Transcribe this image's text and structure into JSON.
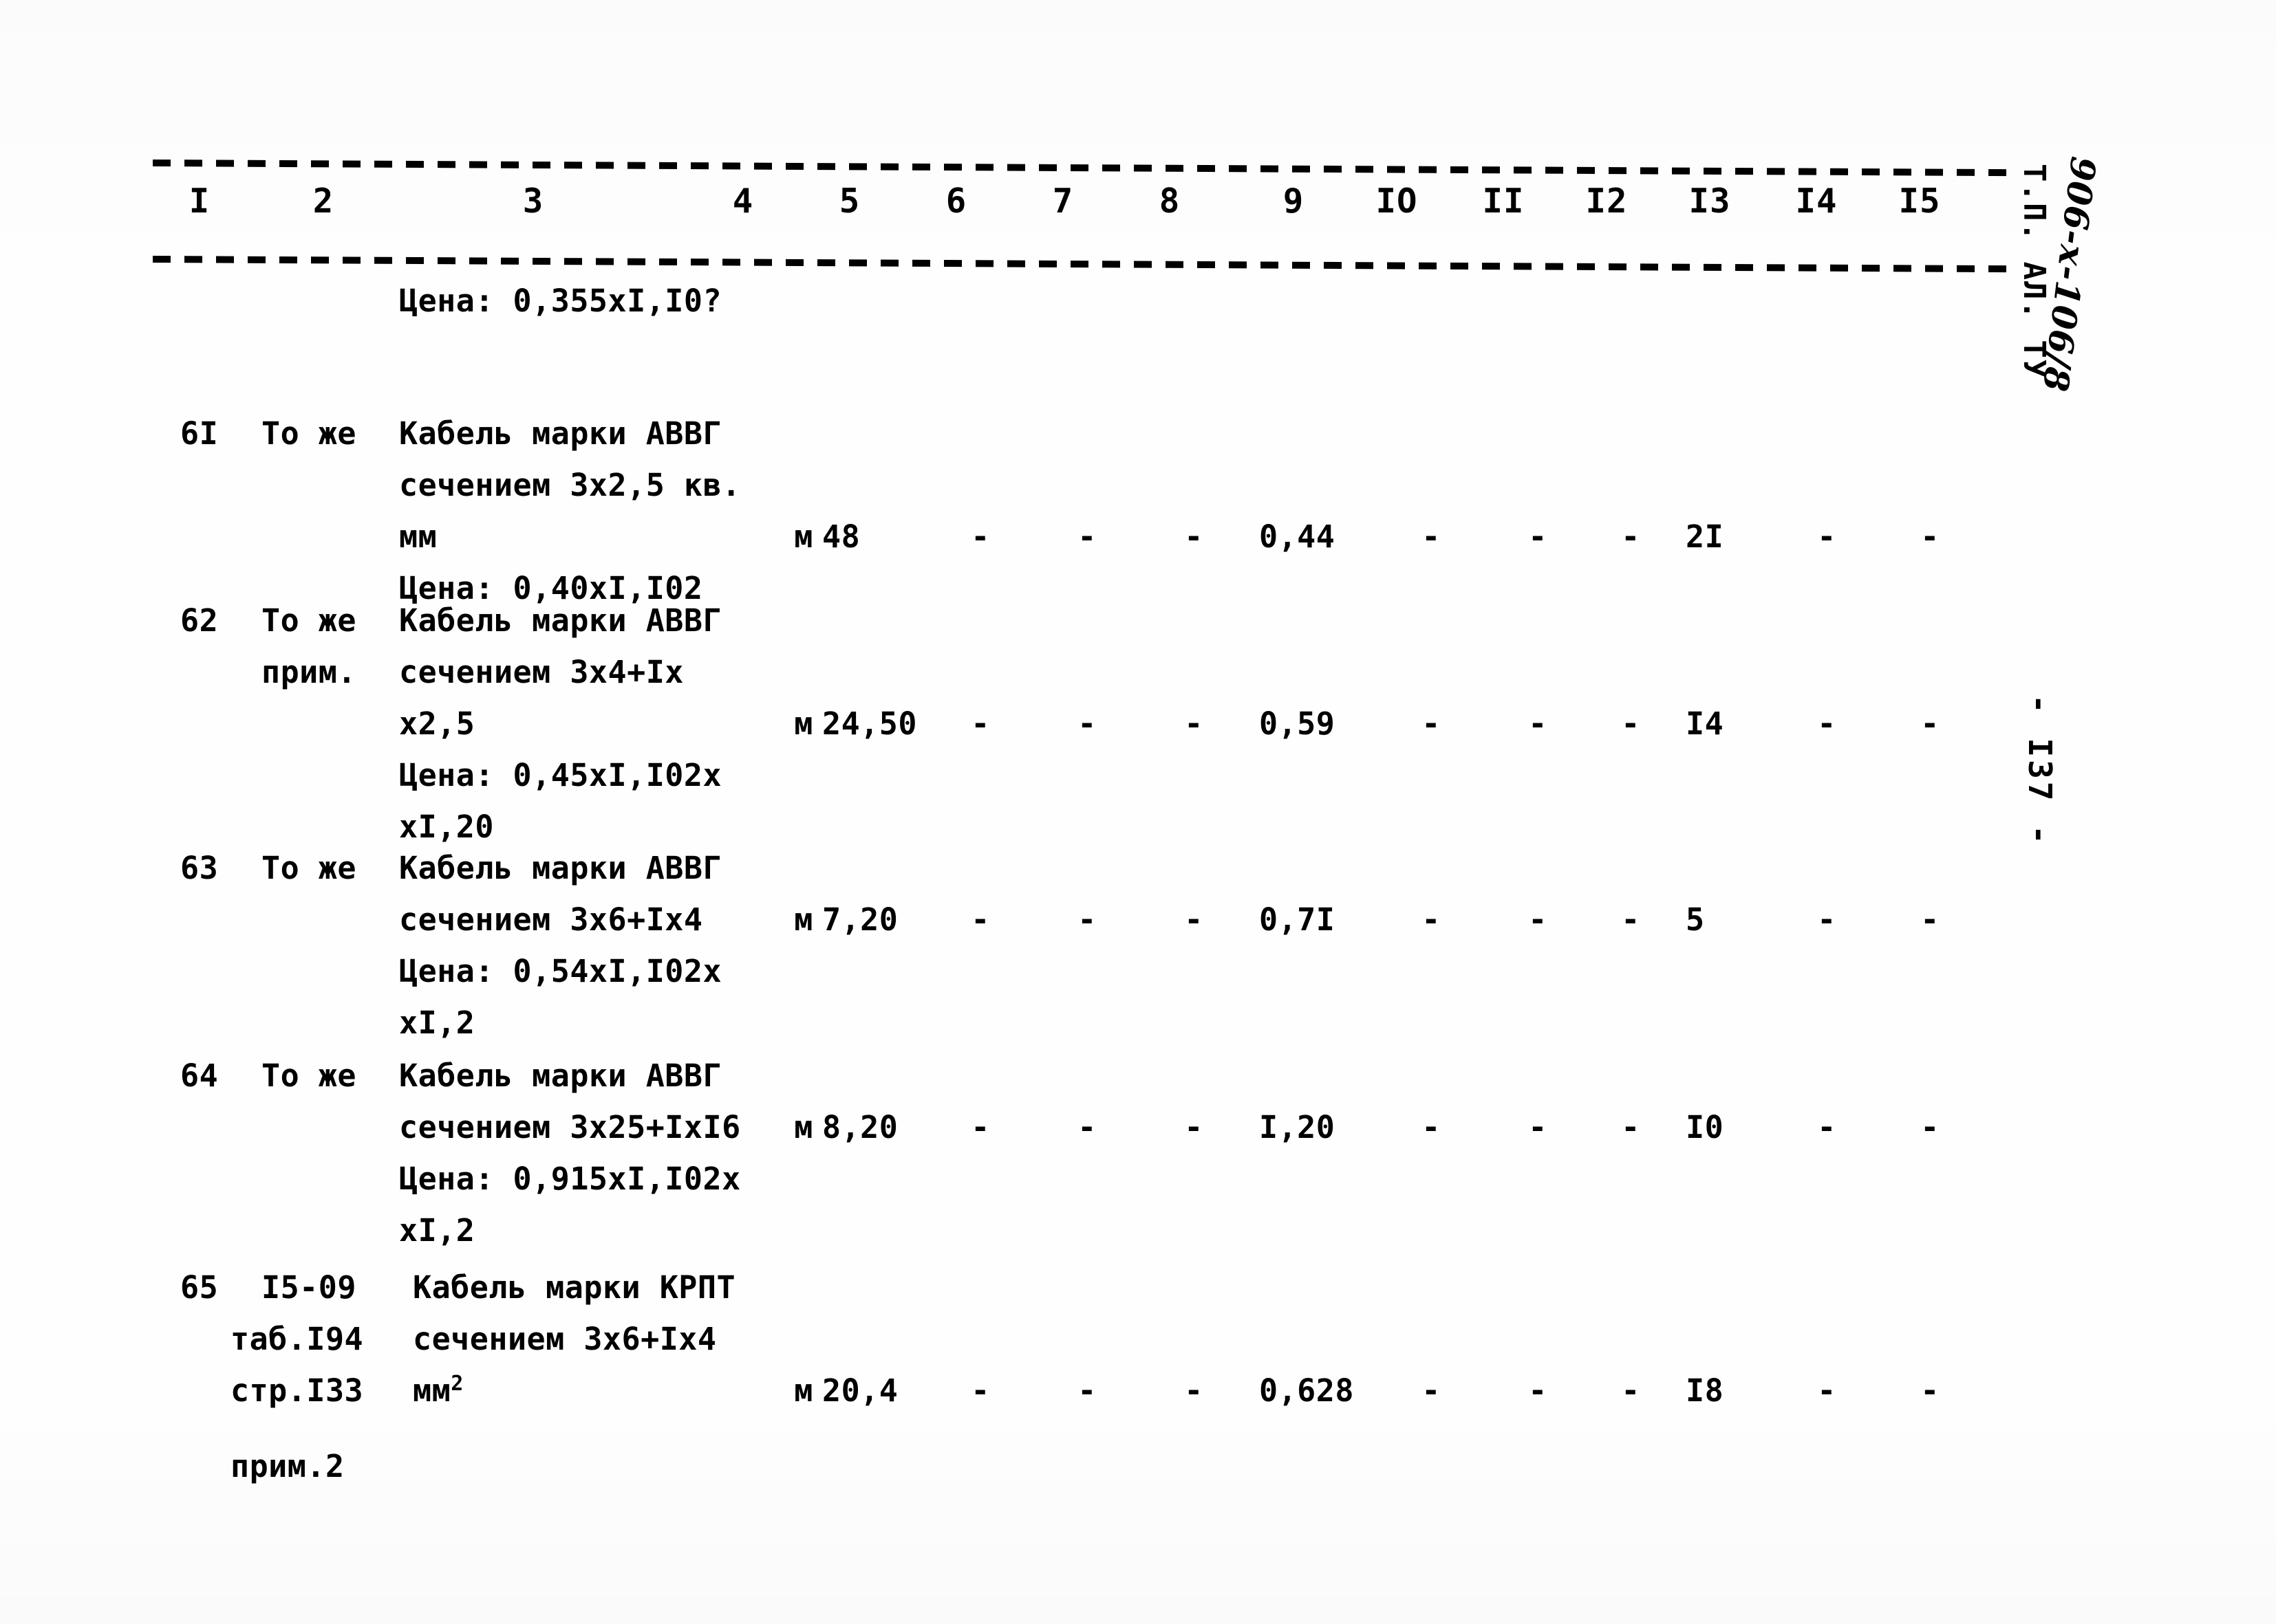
{
  "document": {
    "doc_code": "Т.П. АЛ. ТУ",
    "hand_code": "906-х-106/8",
    "page_number": "- I37 -"
  },
  "table": {
    "column_headers": [
      "I",
      "2",
      "3",
      "4",
      "5",
      "6",
      "7",
      "8",
      "9",
      "IO",
      "II",
      "I2",
      "I3",
      "I4",
      "I5"
    ],
    "rows": [
      {
        "no": "",
        "justification": "",
        "name_lines": [
          "Цена: 0,355хI,I0?"
        ],
        "unit": "",
        "qty": "",
        "dash1": "",
        "dash2": "",
        "dash3": "",
        "value": "",
        "dash4": "",
        "dash5": "",
        "dash6": "",
        "count": "",
        "dash7": "",
        "dash8": ""
      },
      {
        "no": "6I",
        "justification": "То же",
        "name_lines": [
          "Кабель марки АВВГ",
          "сечением 3х2,5 кв.",
          "мм",
          "Цена: 0,40хI,I02"
        ],
        "unit": "м",
        "qty": "48",
        "dash1": "-",
        "dash2": "-",
        "dash3": "-",
        "value": "0,44",
        "dash4": "-",
        "dash5": "-",
        "dash6": "-",
        "count": "2I",
        "dash7": "-",
        "dash8": "-"
      },
      {
        "no": "62",
        "justification": "То же",
        "justification2": "прим.",
        "name_lines": [
          "Кабель марки АВВГ",
          "сечением 3х4+Iх",
          "х2,5",
          "Цена: 0,45хI,I02х",
          "хI,20"
        ],
        "unit": "м",
        "qty": "24,50",
        "dash1": "-",
        "dash2": "-",
        "dash3": "-",
        "value": "0,59",
        "dash4": "-",
        "dash5": "-",
        "dash6": "-",
        "count": "I4",
        "dash7": "-",
        "dash8": "-"
      },
      {
        "no": "63",
        "justification": "То же",
        "name_lines": [
          "Кабель марки АВВГ",
          "сечением 3х6+Iх4",
          "Цена: 0,54хI,I02х",
          "хI,2"
        ],
        "unit": "м",
        "qty": "7,20",
        "dash1": "-",
        "dash2": "-",
        "dash3": "-",
        "value": "0,7I",
        "dash4": "-",
        "dash5": "-",
        "dash6": "-",
        "count": "5",
        "dash7": "-",
        "dash8": "-"
      },
      {
        "no": "64",
        "justification": "То же",
        "name_lines": [
          "Кабель марки АВВГ",
          "сечением 3х25+IхI6",
          "Цена: 0,915хI,I02х",
          "хI,2"
        ],
        "unit": "м",
        "qty": "8,20",
        "dash1": "-",
        "dash2": "-",
        "dash3": "-",
        "value": "I,20",
        "dash4": "-",
        "dash5": "-",
        "dash6": "-",
        "count": "I0",
        "dash7": "-",
        "dash8": "-"
      },
      {
        "no": "65",
        "justification": "I5-09",
        "justification_lines": [
          "I5-09",
          "таб.I94",
          "стр.I33",
          "прим.2"
        ],
        "name_lines": [
          "Кабель марки КРПТ",
          "сечением 3х6+Iх4",
          "мм",
          ""
        ],
        "name_superscript": "2",
        "unit": "м",
        "qty": "20,4",
        "dash1": "-",
        "dash2": "-",
        "dash3": "-",
        "value": "0,628",
        "dash4": "-",
        "dash5": "-",
        "dash6": "-",
        "count": "I8",
        "dash7": "-",
        "dash8": "-"
      }
    ]
  }
}
